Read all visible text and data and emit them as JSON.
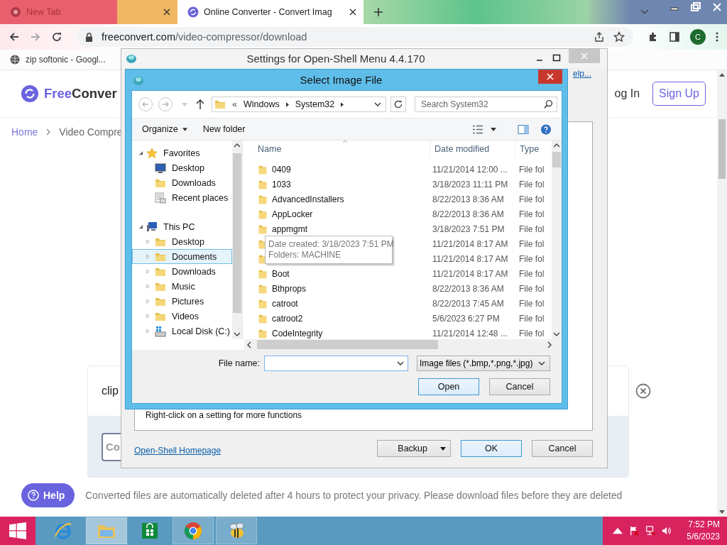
{
  "browser": {
    "tabs": [
      {
        "title": "New Tab",
        "selected": false
      },
      {
        "selected": false
      },
      {
        "title": "Online Converter - Convert Imag",
        "selected": true
      }
    ],
    "url_host": "freeconvert.com",
    "url_path": "/video-compressor/download",
    "bookmarks": [
      "zip softonic - Googl..."
    ],
    "profile": "C"
  },
  "page": {
    "brand_a": "Free",
    "brand_b": "Conver",
    "login": "og In",
    "signup": "Sign Up",
    "breadcrumb": [
      "Home",
      "Video Compre"
    ],
    "file_name": "clip",
    "button": "Co",
    "notice": "Converted files are automatically deleted after 4 hours to protect your privacy. Please download files before they are deleted",
    "help": "Help"
  },
  "settings_dialog": {
    "title": "Settings for Open-Shell Menu 4.4.170",
    "help_link": "elp...",
    "hint": "Right-click on a setting for more functions",
    "homepage_link": "Open-Shell Homepage",
    "buttons": [
      {
        "label": "Backup",
        "kind": "split"
      },
      {
        "label": "OK",
        "kind": "default"
      },
      {
        "label": "Cancel",
        "kind": "plain"
      }
    ]
  },
  "file_dialog": {
    "title": "Select Image File",
    "path_prefix": "«",
    "path": [
      "Windows",
      "System32"
    ],
    "search_placeholder": "Search System32",
    "toolbar": [
      "Organize",
      "New folder"
    ],
    "tree": [
      {
        "label": "Favorites",
        "kind": "star",
        "expanded": true,
        "selected": false,
        "children": [
          {
            "label": "Desktop",
            "kind": "monitor",
            "selected": false
          },
          {
            "label": "Downloads",
            "kind": "folder",
            "selected": false
          },
          {
            "label": "Recent places",
            "kind": "recent",
            "selected": false
          }
        ]
      },
      {
        "label": "This PC",
        "kind": "pc",
        "expanded": true,
        "selected": false,
        "children": [
          {
            "label": "Desktop",
            "kind": "folder",
            "expanded": false,
            "selected": false
          },
          {
            "label": "Documents",
            "kind": "folder",
            "expanded": false,
            "selected": true
          },
          {
            "label": "Downloads",
            "kind": "folder",
            "expanded": false,
            "selected": false
          },
          {
            "label": "Music",
            "kind": "folder",
            "expanded": false,
            "selected": false
          },
          {
            "label": "Pictures",
            "kind": "folder",
            "expanded": false,
            "selected": false
          },
          {
            "label": "Videos",
            "kind": "folder",
            "expanded": false,
            "selected": false
          },
          {
            "label": "Local Disk (C:)",
            "kind": "disk",
            "expanded": false,
            "selected": false
          }
        ]
      }
    ],
    "columns": [
      "Name",
      "Date modified",
      "Type"
    ],
    "rows": [
      {
        "name": "0409",
        "date": "11/21/2014 12:00 ...",
        "type": "File fol"
      },
      {
        "name": "1033",
        "date": "3/18/2023 11:11 PM",
        "type": "File fol"
      },
      {
        "name": "AdvancedInstallers",
        "date": "8/22/2013 8:36 AM",
        "type": "File fol"
      },
      {
        "name": "AppLocker",
        "date": "8/22/2013 8:36 AM",
        "type": "File fol"
      },
      {
        "name": "appmgmt",
        "date": "3/18/2023 7:51 PM",
        "type": "File fol"
      },
      {
        "date": "11/21/2014 8:17 AM",
        "type": "File fol"
      },
      {
        "date": "11/21/2014 8:17 AM",
        "type": "File fol"
      },
      {
        "name": "Boot",
        "date": "11/21/2014 8:17 AM",
        "type": "File fol"
      },
      {
        "name": "Bthprops",
        "date": "8/22/2013 8:36 AM",
        "type": "File fol"
      },
      {
        "name": "catroot",
        "date": "8/22/2013 7:45 AM",
        "type": "File fol"
      },
      {
        "name": "catroot2",
        "date": "5/6/2023 6:27 PM",
        "type": "File fol"
      },
      {
        "name": "CodeIntegrity",
        "date": "11/21/2014 12:48 ...",
        "type": "File fol"
      }
    ],
    "tooltip": [
      "Date created: 3/18/2023 7:51 PM",
      "Folders: MACHINE"
    ],
    "file_name_label": "File name:",
    "filter": "Image files (*.bmp,*.png,*.jpg)",
    "buttons": [
      {
        "label": "Open",
        "kind": "default"
      },
      {
        "label": "Cancel",
        "kind": "plain"
      }
    ]
  },
  "taskbar": {
    "apps": [
      {
        "kind": "ie",
        "selected": false,
        "running": false
      },
      {
        "kind": "explorer",
        "selected": true,
        "running": true
      },
      {
        "kind": "store",
        "selected": false,
        "running": false
      },
      {
        "kind": "chrome",
        "selected": false,
        "running": true
      },
      {
        "kind": "bee",
        "selected": false,
        "running": true
      }
    ],
    "time": "7:52 PM",
    "date": "5/6/2023"
  }
}
